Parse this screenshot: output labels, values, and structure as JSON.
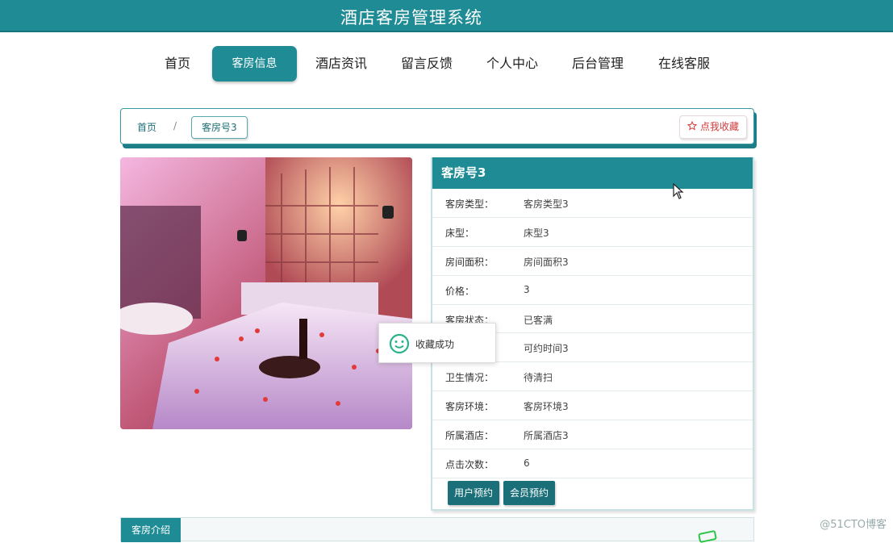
{
  "header": {
    "title": "酒店客房管理系统"
  },
  "nav": {
    "items": [
      {
        "label": "首页"
      },
      {
        "label": "客房信息"
      },
      {
        "label": "酒店资讯"
      },
      {
        "label": "留言反馈"
      },
      {
        "label": "个人中心"
      },
      {
        "label": "后台管理"
      },
      {
        "label": "在线客服"
      }
    ],
    "active_index": 1
  },
  "breadcrumb": {
    "home": "首页",
    "separator": "/",
    "current": "客房号3"
  },
  "favorite_button": {
    "label": "点我收藏",
    "icon": "star-outline-icon"
  },
  "room": {
    "title": "客房号3",
    "fields": [
      {
        "key": "客房类型：",
        "value": "客房类型3"
      },
      {
        "key": "床型：",
        "value": "床型3"
      },
      {
        "key": "房间面积：",
        "value": "房间面积3"
      },
      {
        "key": "价格：",
        "value": "3"
      },
      {
        "key": "客房状态：",
        "value": "已客满"
      },
      {
        "key": "",
        "value": "可约时间3"
      },
      {
        "key": "卫生情况：",
        "value": "待清扫"
      },
      {
        "key": "客房环境：",
        "value": "客房环境3"
      },
      {
        "key": "所属酒店：",
        "value": "所属酒店3"
      },
      {
        "key": "点击次数：",
        "value": "6"
      }
    ],
    "actions": {
      "user_booking": "用户预约",
      "member_booking": "会员预约"
    }
  },
  "toast": {
    "message": "收藏成功",
    "icon": "smile-icon"
  },
  "intro": {
    "tab": "客房介绍"
  },
  "watermark": "@51CTO博客",
  "colors": {
    "primary": "#1e8b95",
    "dark_button": "#1a6f78",
    "favorite_red": "#d33b3b"
  }
}
